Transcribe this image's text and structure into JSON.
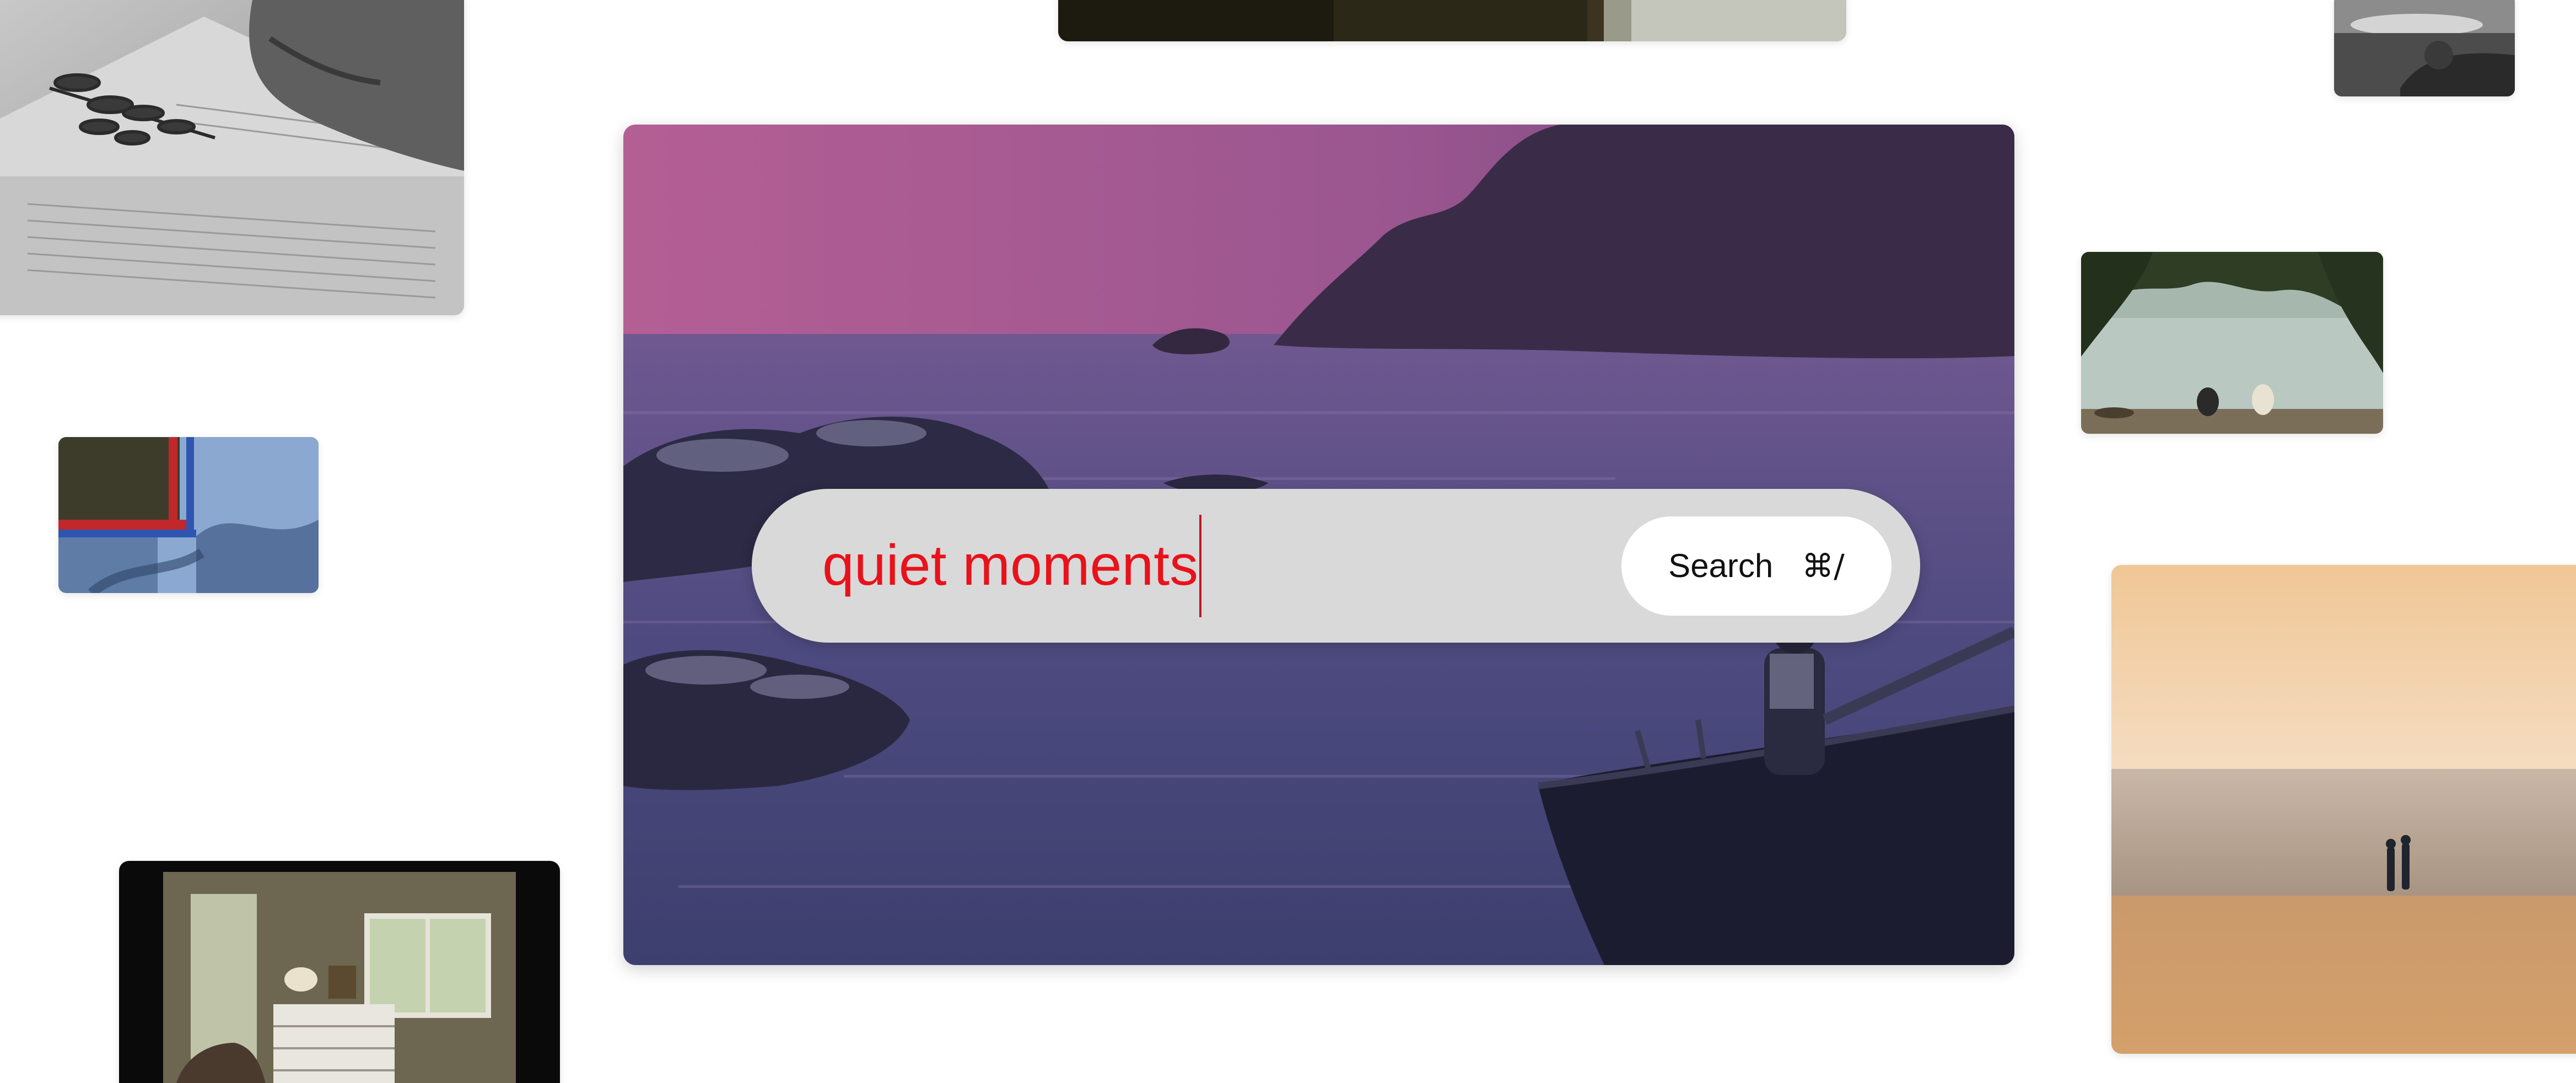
{
  "search": {
    "query": "quiet moments",
    "button_label": "Search",
    "shortcut": "⌘/"
  },
  "colors": {
    "background": "#ffffff",
    "search_bar": "#d9d9d9",
    "query_text": "#e8121b",
    "button_bg": "#ffffff"
  },
  "thumbnails": [
    {
      "name": "book-fern-photo"
    },
    {
      "name": "window-frame-photo"
    },
    {
      "name": "boat-sunset-photo"
    },
    {
      "name": "blue-window-photo"
    },
    {
      "name": "lake-trees-photo"
    },
    {
      "name": "bedroom-photo"
    },
    {
      "name": "beach-walkers-photo"
    },
    {
      "name": "purple-coast-photo"
    }
  ]
}
